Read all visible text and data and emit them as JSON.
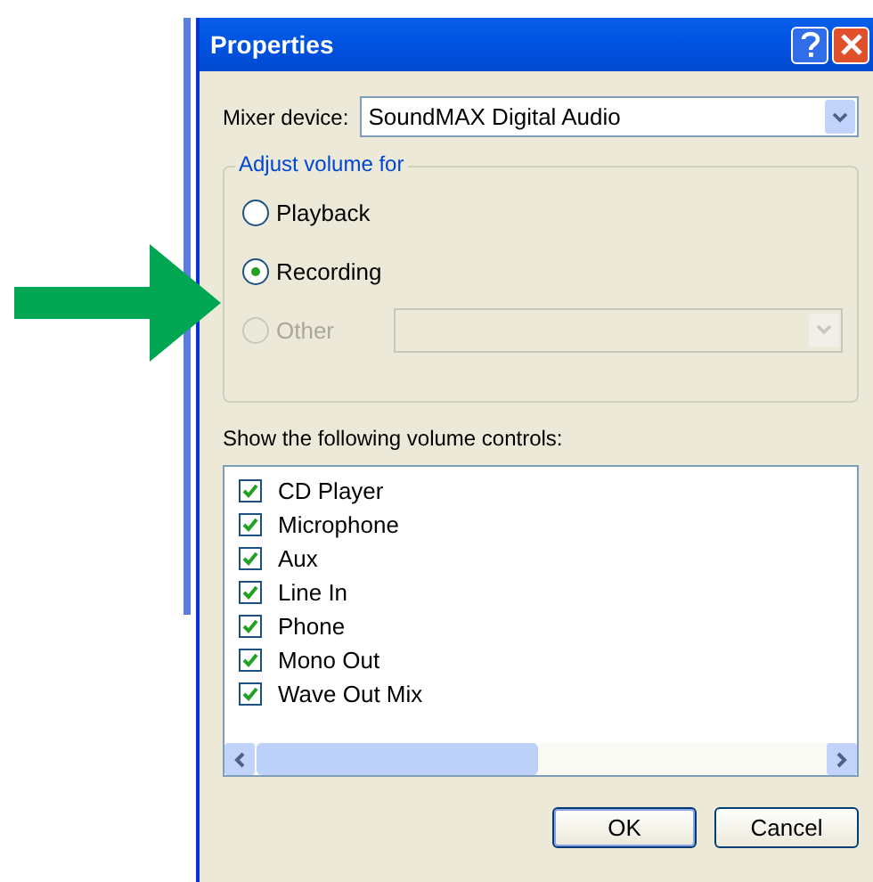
{
  "window": {
    "title": "Properties"
  },
  "mixer_device": {
    "label": "Mixer device:",
    "value": "SoundMAX Digital Audio"
  },
  "adjust_group": {
    "title": "Adjust volume for",
    "options": [
      {
        "label": "Playback",
        "selected": false,
        "disabled": false
      },
      {
        "label": "Recording",
        "selected": true,
        "disabled": false
      },
      {
        "label": "Other",
        "selected": false,
        "disabled": true
      }
    ],
    "other_device": {
      "disabled": true
    }
  },
  "controls_label": "Show the following volume controls:",
  "controls": [
    {
      "label": "CD Player",
      "checked": true
    },
    {
      "label": "Microphone",
      "checked": true
    },
    {
      "label": "Aux",
      "checked": true
    },
    {
      "label": "Line In",
      "checked": true
    },
    {
      "label": "Phone",
      "checked": true
    },
    {
      "label": "Mono Out",
      "checked": true
    },
    {
      "label": "Wave Out Mix",
      "checked": true
    }
  ],
  "buttons": [
    "OK",
    "Cancel"
  ]
}
